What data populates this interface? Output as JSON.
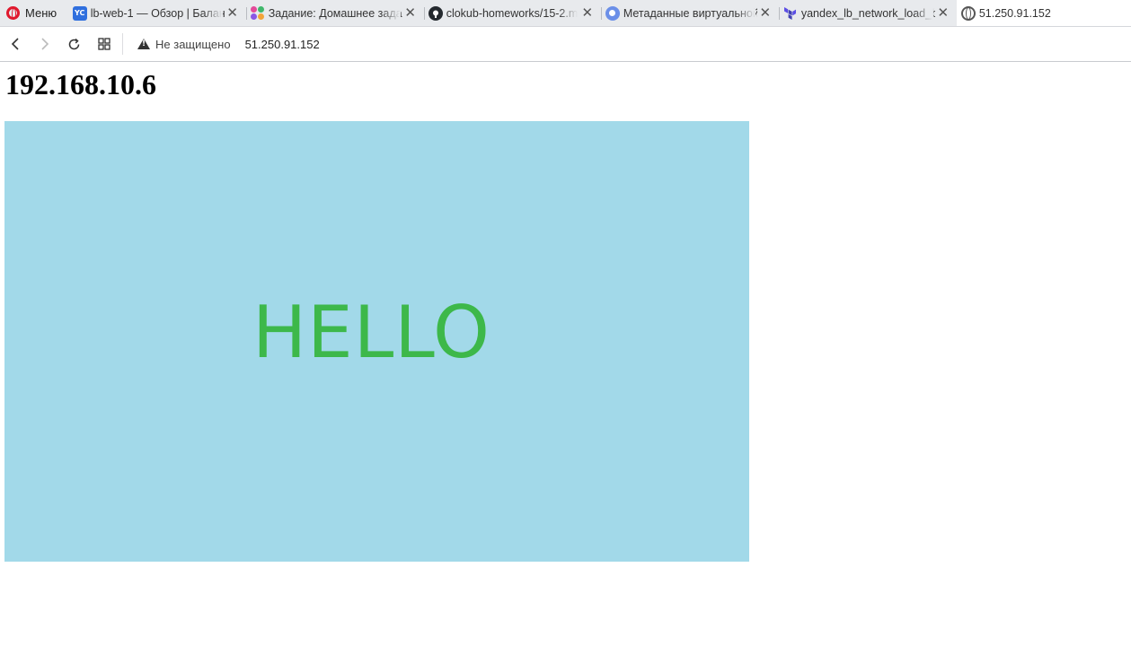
{
  "browser": {
    "menu_label": "Меню",
    "tabs": [
      {
        "title": "lb-web-1 — Обзор | Балан",
        "icon": "yc-icon",
        "badge": "YC"
      },
      {
        "title": "Задание: Домашнее задан",
        "icon": "task-dots-icon"
      },
      {
        "title": "clokub-homeworks/15-2.m",
        "icon": "github-icon"
      },
      {
        "title": "Метаданные виртуальной",
        "icon": "metadata-icon"
      },
      {
        "title": "yandex_lb_network_load_b",
        "icon": "terraform-icon"
      },
      {
        "title": "51.250.91.152",
        "icon": "globe-icon",
        "active": true
      }
    ],
    "security_label": "Не защищено",
    "url": "51.250.91.152"
  },
  "page": {
    "heading": "192.168.10.6",
    "banner_text": "HELLO",
    "banner_bg": "#a2d9e9",
    "banner_text_color": "#3db84a"
  }
}
